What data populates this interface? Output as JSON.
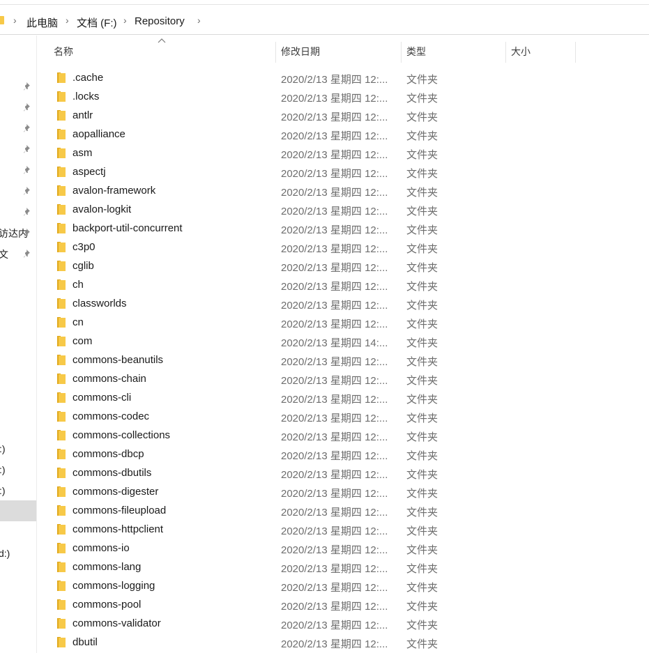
{
  "breadcrumb": {
    "items": [
      "此电脑",
      "文档 (F:)",
      "Repository"
    ]
  },
  "sidebar": {
    "labels": [
      "访达内",
      "文",
      ":)",
      ":)",
      ":)",
      "d:)"
    ],
    "pin_count": 9
  },
  "columns": {
    "name": "名称",
    "date": "修改日期",
    "type": "类型",
    "size": "大小"
  },
  "files": [
    {
      "name": ".cache",
      "date": "2020/2/13 星期四 12:...",
      "type": "文件夹"
    },
    {
      "name": ".locks",
      "date": "2020/2/13 星期四 12:...",
      "type": "文件夹"
    },
    {
      "name": "antlr",
      "date": "2020/2/13 星期四 12:...",
      "type": "文件夹"
    },
    {
      "name": "aopalliance",
      "date": "2020/2/13 星期四 12:...",
      "type": "文件夹"
    },
    {
      "name": "asm",
      "date": "2020/2/13 星期四 12:...",
      "type": "文件夹"
    },
    {
      "name": "aspectj",
      "date": "2020/2/13 星期四 12:...",
      "type": "文件夹"
    },
    {
      "name": "avalon-framework",
      "date": "2020/2/13 星期四 12:...",
      "type": "文件夹"
    },
    {
      "name": "avalon-logkit",
      "date": "2020/2/13 星期四 12:...",
      "type": "文件夹"
    },
    {
      "name": "backport-util-concurrent",
      "date": "2020/2/13 星期四 12:...",
      "type": "文件夹"
    },
    {
      "name": "c3p0",
      "date": "2020/2/13 星期四 12:...",
      "type": "文件夹"
    },
    {
      "name": "cglib",
      "date": "2020/2/13 星期四 12:...",
      "type": "文件夹"
    },
    {
      "name": "ch",
      "date": "2020/2/13 星期四 12:...",
      "type": "文件夹"
    },
    {
      "name": "classworlds",
      "date": "2020/2/13 星期四 12:...",
      "type": "文件夹"
    },
    {
      "name": "cn",
      "date": "2020/2/13 星期四 12:...",
      "type": "文件夹"
    },
    {
      "name": "com",
      "date": "2020/2/13 星期四 14:...",
      "type": "文件夹"
    },
    {
      "name": "commons-beanutils",
      "date": "2020/2/13 星期四 12:...",
      "type": "文件夹"
    },
    {
      "name": "commons-chain",
      "date": "2020/2/13 星期四 12:...",
      "type": "文件夹"
    },
    {
      "name": "commons-cli",
      "date": "2020/2/13 星期四 12:...",
      "type": "文件夹"
    },
    {
      "name": "commons-codec",
      "date": "2020/2/13 星期四 12:...",
      "type": "文件夹"
    },
    {
      "name": "commons-collections",
      "date": "2020/2/13 星期四 12:...",
      "type": "文件夹"
    },
    {
      "name": "commons-dbcp",
      "date": "2020/2/13 星期四 12:...",
      "type": "文件夹"
    },
    {
      "name": "commons-dbutils",
      "date": "2020/2/13 星期四 12:...",
      "type": "文件夹"
    },
    {
      "name": "commons-digester",
      "date": "2020/2/13 星期四 12:...",
      "type": "文件夹"
    },
    {
      "name": "commons-fileupload",
      "date": "2020/2/13 星期四 12:...",
      "type": "文件夹"
    },
    {
      "name": "commons-httpclient",
      "date": "2020/2/13 星期四 12:...",
      "type": "文件夹"
    },
    {
      "name": "commons-io",
      "date": "2020/2/13 星期四 12:...",
      "type": "文件夹"
    },
    {
      "name": "commons-lang",
      "date": "2020/2/13 星期四 12:...",
      "type": "文件夹"
    },
    {
      "name": "commons-logging",
      "date": "2020/2/13 星期四 12:...",
      "type": "文件夹"
    },
    {
      "name": "commons-pool",
      "date": "2020/2/13 星期四 12:...",
      "type": "文件夹"
    },
    {
      "name": "commons-validator",
      "date": "2020/2/13 星期四 12:...",
      "type": "文件夹"
    },
    {
      "name": "dbutil",
      "date": "2020/2/13 星期四 12:...",
      "type": "文件夹"
    }
  ],
  "colors": {
    "folder": "#f7c948",
    "folder_dark": "#e0a81c",
    "selected": "#dcdcdc"
  }
}
